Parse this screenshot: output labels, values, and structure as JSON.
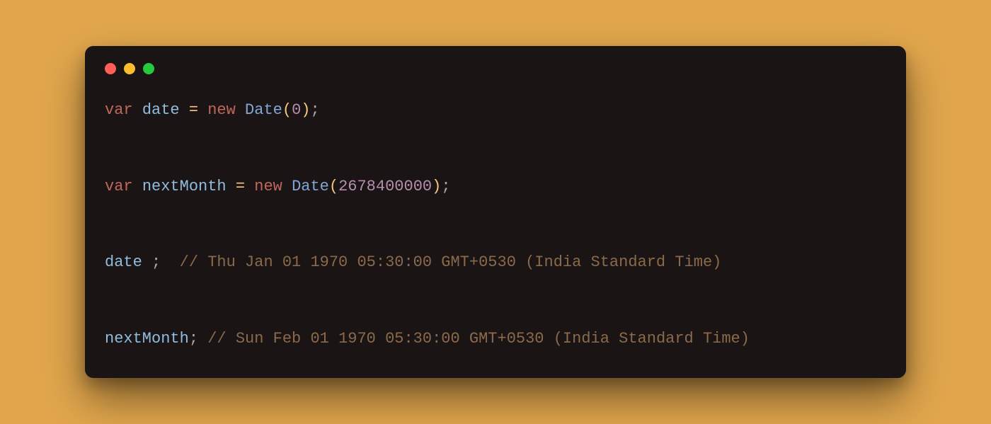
{
  "code": {
    "line1": {
      "kw_var": "var",
      "ident": "date",
      "op_eq": "=",
      "kw_new": "new",
      "type": "Date",
      "lparen": "(",
      "num": "0",
      "rparen": ")",
      "semi": ";"
    },
    "line2": {
      "kw_var": "var",
      "ident": "nextMonth",
      "op_eq": "=",
      "kw_new": "new",
      "type": "Date",
      "lparen": "(",
      "num": "2678400000",
      "rparen": ")",
      "semi": ";"
    },
    "line3": {
      "ident": "date",
      "semi": ";",
      "comment": "// Thu Jan 01 1970 05:30:00 GMT+0530 (India Standard Time)"
    },
    "line4": {
      "ident": "nextMonth",
      "semi": ";",
      "comment": "// Sun Feb 01 1970 05:30:00 GMT+0530 (India Standard Time)"
    }
  }
}
